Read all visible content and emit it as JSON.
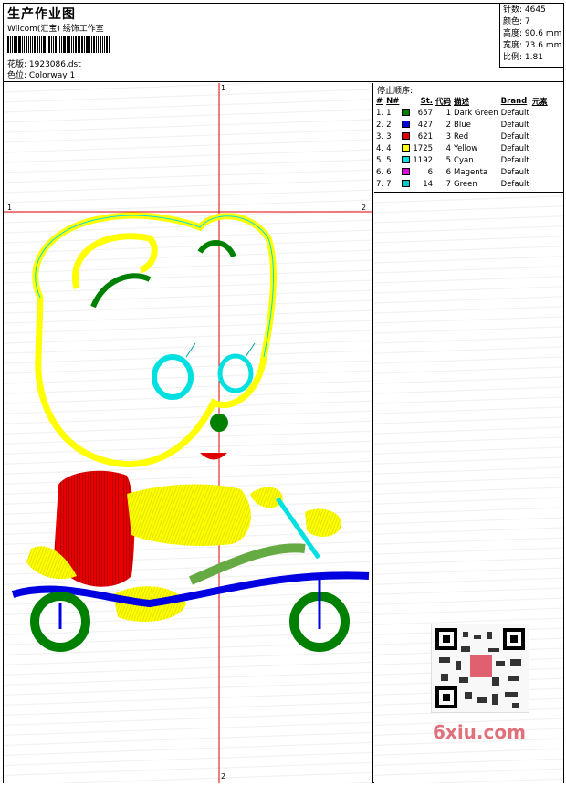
{
  "header": {
    "title": "生产作业图",
    "software": "Wilcom(汇宝) 绣饰工作室",
    "design_label": "花版: 1923086.dst",
    "colorway_label": "色位: Colorway 1"
  },
  "stats": [
    {
      "label": "针数",
      "value": "4645"
    },
    {
      "label": "颜色",
      "value": "7"
    },
    {
      "label": "高度",
      "value": "90.6 mm"
    },
    {
      "label": "宽度",
      "value": "73.6 mm"
    },
    {
      "label": "比例",
      "value": "1.81"
    }
  ],
  "sequence": {
    "title": "停止顺序:",
    "headers": [
      "#",
      "N#",
      "St.",
      "代码",
      "描述",
      "Brand",
      "元素"
    ],
    "rows": [
      {
        "seq": "1.",
        "n": "1",
        "color": "#008000",
        "stitches": "657",
        "code": "1",
        "desc": "Dark Green",
        "brand": "Default"
      },
      {
        "seq": "2.",
        "n": "2",
        "color": "#0000e0",
        "stitches": "427",
        "code": "2",
        "desc": "Blue",
        "brand": "Default"
      },
      {
        "seq": "3.",
        "n": "3",
        "color": "#e00000",
        "stitches": "621",
        "code": "3",
        "desc": "Red",
        "brand": "Default"
      },
      {
        "seq": "4.",
        "n": "4",
        "color": "#ffff00",
        "stitches": "1725",
        "code": "4",
        "desc": "Yellow",
        "brand": "Default"
      },
      {
        "seq": "5.",
        "n": "5",
        "color": "#00e0e0",
        "stitches": "1192",
        "code": "5",
        "desc": "Cyan",
        "brand": "Default"
      },
      {
        "seq": "6.",
        "n": "6",
        "color": "#e000e0",
        "stitches": "6",
        "code": "6",
        "desc": "Magenta",
        "brand": "Default"
      },
      {
        "seq": "7.",
        "n": "7",
        "color": "#00c8c8",
        "stitches": "14",
        "code": "7",
        "desc": "Green",
        "brand": "Default"
      }
    ]
  },
  "axes": {
    "top": "1",
    "bottom": "2",
    "left": "1",
    "right": "2"
  },
  "watermark": "6xiu.com",
  "colors": {
    "guide": "#e00000",
    "axis_label": "#00a0a0"
  }
}
